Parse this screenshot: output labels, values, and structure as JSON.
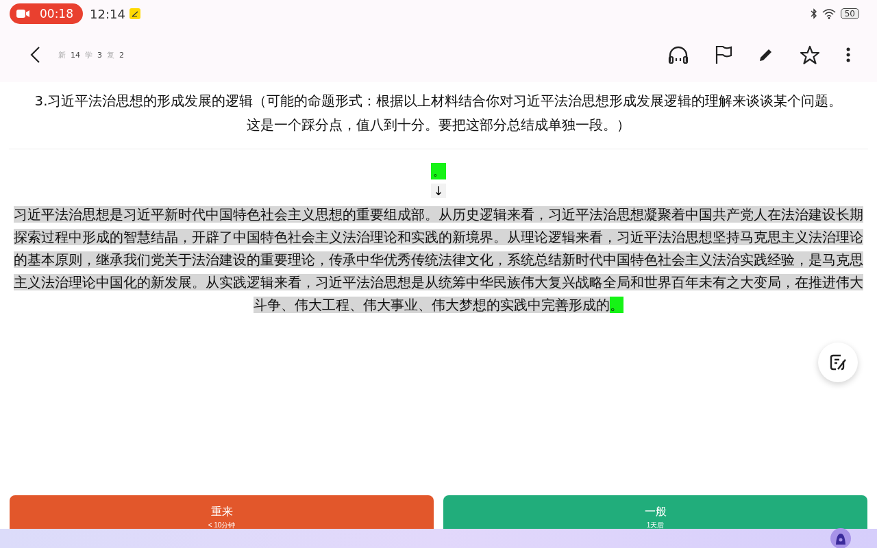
{
  "status_bar": {
    "recording_time": "00:18",
    "time": "12:14",
    "battery": "50"
  },
  "toolbar": {
    "counts": [
      {
        "label": "新",
        "count": "14"
      },
      {
        "label": "学",
        "count": "3"
      },
      {
        "label": "复",
        "count": "2"
      }
    ]
  },
  "card": {
    "question_lines": [
      "3.习近平法治思想的形成发展的逻辑（可能的命题形式：根据以上材料结合你对习近平法治思想形成发展逻辑的理解来谈谈某个问题。",
      "这是一个踩分点，值八到十分。要把这部分总结成单独一段。）"
    ],
    "marker": "。",
    "arrow": "↓",
    "answer": "习近平法治思想是习近平新时代中国特色社会主义思想的重要组成部。从历史逻辑来看，习近平法治思想凝聚着中国共产党人在法治建设长期探索过程中形成的智慧结晶，开辟了中国特色社会主义法治理论和实践的新境界。从理论逻辑来看，习近平法治思想坚持马克思主义法治理论的基本原则，继承我们党关于法治建设的重要理论，传承中华优秀传统法律文化，系统总结新时代中国特色社会主义法治实践经验，是马克思主义法治理论中国化的新发展。从实践逻辑来看，习近平法治思想是从统筹中华民族伟大复兴战略全局和世界百年未有之大变局，在推进伟大斗争、伟大工程、伟大事业、伟大梦想的实践中完善形成的",
    "answer_end": "。"
  },
  "answer_buttons": [
    {
      "kind": "again",
      "label": "重来",
      "sublabel": "< 10分钟"
    },
    {
      "kind": "good",
      "label": "一般",
      "sublabel": "1天后"
    }
  ]
}
